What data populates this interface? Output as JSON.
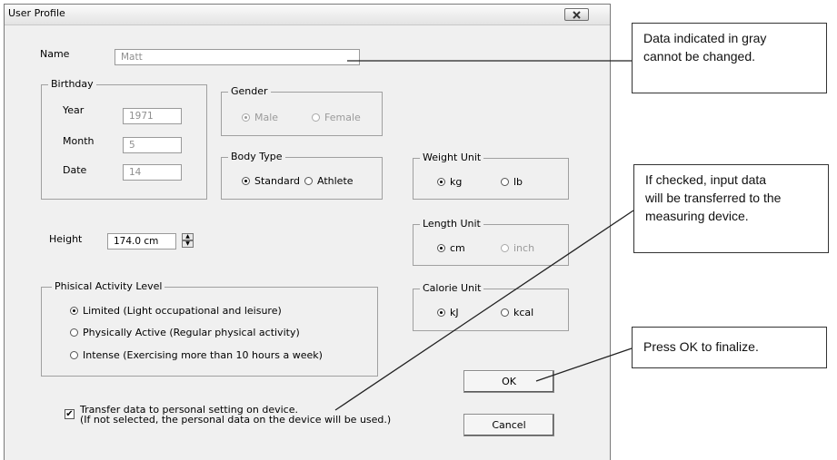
{
  "dialog": {
    "title": "User Profile",
    "name_label": "Name",
    "name_value": "Matt",
    "birthday": {
      "legend": "Birthday",
      "year_label": "Year",
      "year_value": "1971",
      "month_label": "Month",
      "month_value": "5",
      "date_label": "Date",
      "date_value": "14"
    },
    "gender": {
      "legend": "Gender",
      "male": "Male",
      "female": "Female",
      "selected": "Male"
    },
    "body_type": {
      "legend": "Body Type",
      "standard": "Standard",
      "athlete": "Athlete",
      "selected": "Standard"
    },
    "weight_unit": {
      "legend": "Weight Unit",
      "kg": "kg",
      "lb": "lb",
      "selected": "kg"
    },
    "length_unit": {
      "legend": "Length Unit",
      "cm": "cm",
      "inch": "inch",
      "selected": "cm"
    },
    "calorie_unit": {
      "legend": "Calorie Unit",
      "kj": "kJ",
      "kcal": "kcal",
      "selected": "kJ"
    },
    "height_label": "Height",
    "height_value": "174.0 cm",
    "activity": {
      "legend": "Phisical Activity Level",
      "options": [
        "Limited (Light occupational and leisure)",
        "Physically Active (Regular physical activity)",
        "Intense (Exercising more than 10 hours a week)"
      ],
      "selected_index": 0
    },
    "transfer": {
      "checked": true,
      "line1": "Transfer data to personal setting on device.",
      "line2": "(If not selected, the personal data on the device will be used.)"
    },
    "ok_label": "OK",
    "cancel_label": "Cancel"
  },
  "callouts": {
    "gray": [
      "Data indicated in gray",
      "cannot be changed."
    ],
    "transfer": [
      "If checked, input data",
      "will be transferred to the",
      "measuring device."
    ],
    "ok": [
      "Press OK to finalize."
    ]
  },
  "icons": {
    "close": "close-x-icon",
    "spin": "spinner-arrows-icon",
    "check": "checkmark-icon"
  },
  "colors": {
    "dialog_bg": "#f0f0f0",
    "disabled_text": "#9a9a9a"
  }
}
